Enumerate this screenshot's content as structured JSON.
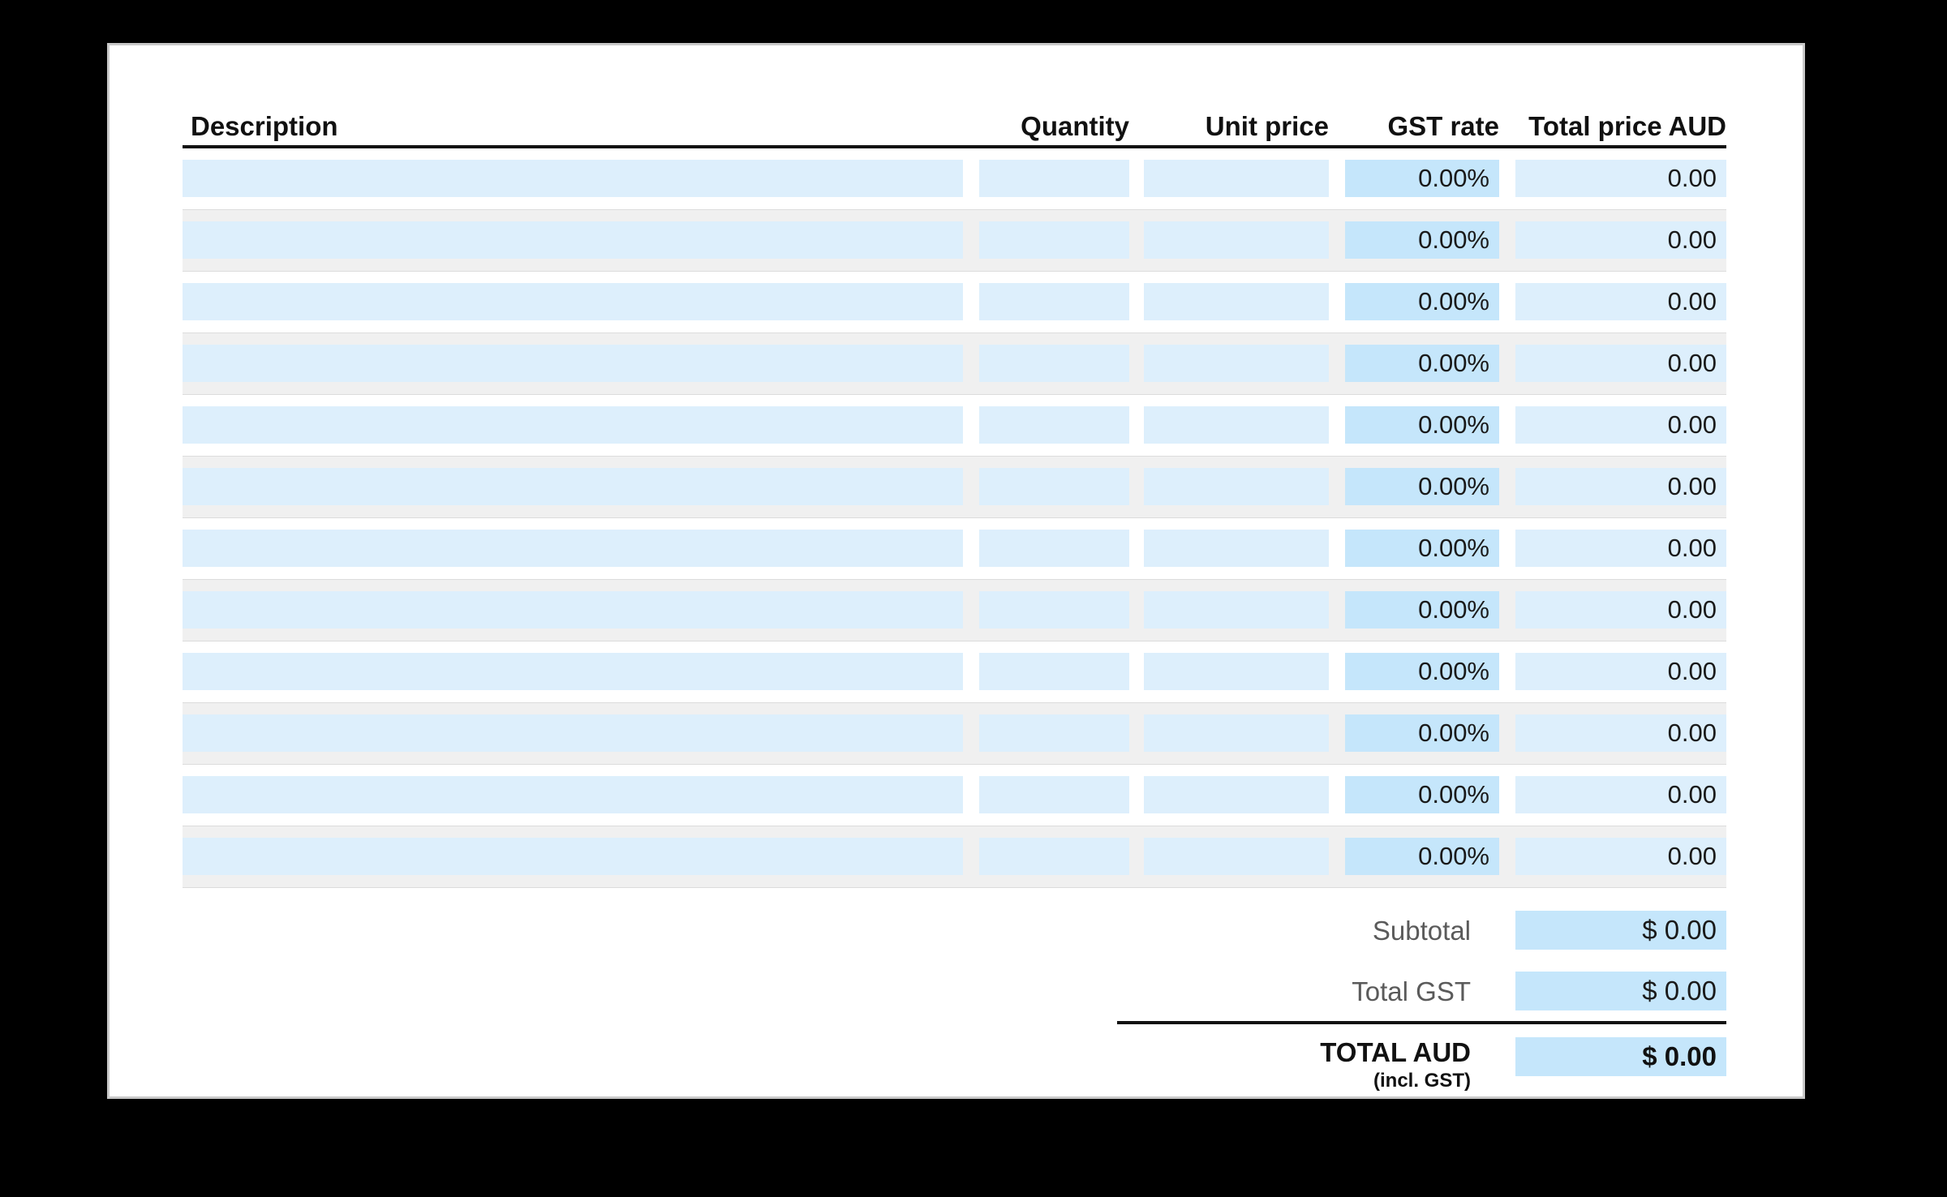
{
  "document": {
    "type": "invoice-line-items-table",
    "currency_code": "AUD"
  },
  "table": {
    "columns": [
      {
        "key": "description",
        "label": "Description",
        "align": "left"
      },
      {
        "key": "quantity",
        "label": "Quantity",
        "align": "right"
      },
      {
        "key": "unit_price",
        "label": "Unit price",
        "align": "right"
      },
      {
        "key": "gst_rate",
        "label": "GST rate",
        "align": "right"
      },
      {
        "key": "total_price",
        "label": "Total price AUD",
        "align": "right"
      }
    ],
    "row_count": 12,
    "rows": [
      {
        "description": "",
        "quantity": "",
        "unit_price": "",
        "gst_rate": "0.00%",
        "total_price": "0.00"
      },
      {
        "description": "",
        "quantity": "",
        "unit_price": "",
        "gst_rate": "0.00%",
        "total_price": "0.00"
      },
      {
        "description": "",
        "quantity": "",
        "unit_price": "",
        "gst_rate": "0.00%",
        "total_price": "0.00"
      },
      {
        "description": "",
        "quantity": "",
        "unit_price": "",
        "gst_rate": "0.00%",
        "total_price": "0.00"
      },
      {
        "description": "",
        "quantity": "",
        "unit_price": "",
        "gst_rate": "0.00%",
        "total_price": "0.00"
      },
      {
        "description": "",
        "quantity": "",
        "unit_price": "",
        "gst_rate": "0.00%",
        "total_price": "0.00"
      },
      {
        "description": "",
        "quantity": "",
        "unit_price": "",
        "gst_rate": "0.00%",
        "total_price": "0.00"
      },
      {
        "description": "",
        "quantity": "",
        "unit_price": "",
        "gst_rate": "0.00%",
        "total_price": "0.00"
      },
      {
        "description": "",
        "quantity": "",
        "unit_price": "",
        "gst_rate": "0.00%",
        "total_price": "0.00"
      },
      {
        "description": "",
        "quantity": "",
        "unit_price": "",
        "gst_rate": "0.00%",
        "total_price": "0.00"
      },
      {
        "description": "",
        "quantity": "",
        "unit_price": "",
        "gst_rate": "0.00%",
        "total_price": "0.00"
      },
      {
        "description": "",
        "quantity": "",
        "unit_price": "",
        "gst_rate": "0.00%",
        "total_price": "0.00"
      }
    ]
  },
  "totals": {
    "subtotal_label": "Subtotal",
    "subtotal_value": "$ 0.00",
    "gst_label": "Total GST",
    "gst_value": "$ 0.00",
    "grand_label": "TOTAL AUD",
    "grand_sublabel": "(incl. GST)",
    "grand_value": "$ 0.00"
  },
  "colors": {
    "field_light": "#ddeffc",
    "field_strong": "#c5e6fb",
    "stripe": "#f0f0f0",
    "rule": "#111111",
    "page_border": "#c8c8c8",
    "backdrop": "#000000"
  }
}
